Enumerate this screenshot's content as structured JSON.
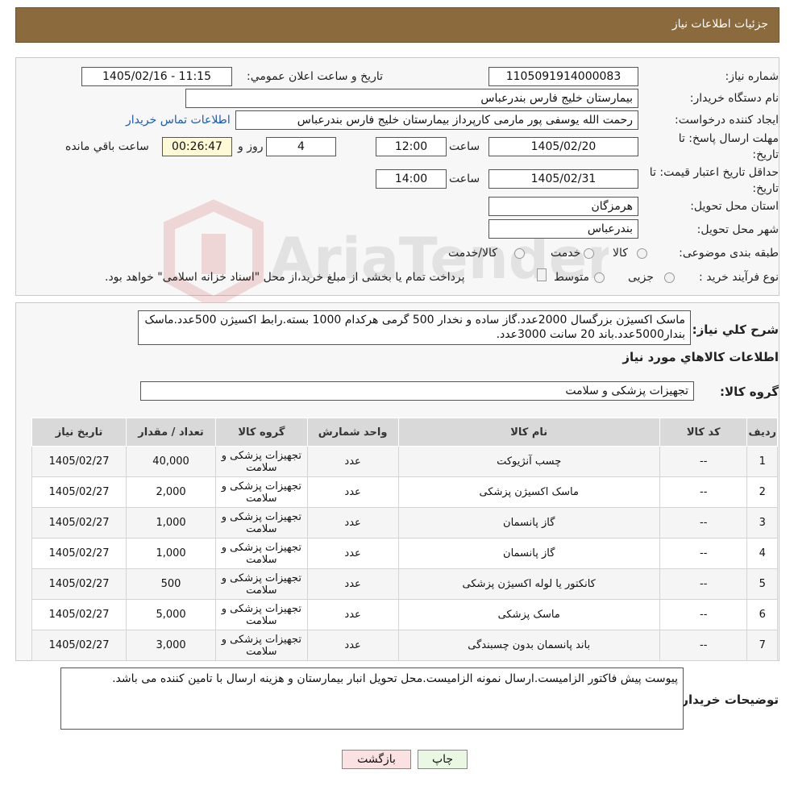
{
  "header": {
    "title": "جزئیات اطلاعات نیاز"
  },
  "need_number": {
    "label": "شماره نیاز:",
    "value": "1105091914000083"
  },
  "announce_date": {
    "label": "تاریخ و ساعت اعلان عمومي:",
    "value": "1405/02/16 - 11:15"
  },
  "buyer_org": {
    "label": "نام دستگاه خريدار:",
    "value": "بیمارستان خلیج فارس بندرعباس"
  },
  "requester": {
    "label": "ايجاد کننده درخواست:",
    "value": "رحمت الله یوسفی پور مارمی کارپرداز بیمارستان خلیج فارس بندرعباس",
    "contact_link": "اطلاعات تماس خريدار"
  },
  "reply_deadline": {
    "label_line1": "مهلت ارسال پاسخ: تا",
    "label_line2": "تاريخ:",
    "date": "1405/02/20",
    "time_label": "ساعت",
    "time": "12:00",
    "days": "4",
    "days_label": "روز و",
    "remaining": "00:26:47",
    "remaining_label": "ساعت باقي مانده"
  },
  "price_validity": {
    "label_line1": "حداقل تاريخ اعتبار قيمت: تا",
    "label_line2": "تاريخ:",
    "date": "1405/02/31",
    "time_label": "ساعت",
    "time": "14:00"
  },
  "province": {
    "label": "استان محل تحويل:",
    "value": "هرمزگان"
  },
  "city": {
    "label": "شهر محل تحويل:",
    "value": "بندرعباس"
  },
  "category": {
    "label": "طبقه بندی موضوعی:",
    "options": [
      "کالا",
      "خدمت",
      "کالا/خدمت"
    ]
  },
  "purchase_type": {
    "label": "نوع فرآیند خرید :",
    "options": [
      "جزیی",
      "متوسط"
    ],
    "note": "پرداخت تمام یا بخشی از مبلغ خرید،از محل \"اسناد خزانه اسلامی\" خواهد بود."
  },
  "watermark": {
    "text": "AriaTender.neT"
  },
  "description": {
    "label": "شرح کلي نياز:",
    "value": "ماسک اکسیژن بزرگسال 2000عدد.گاز ساده و نخدار 500 گرمی هرکدام 1000 بسته.رابط اکسیژن 500عدد.ماسک بندار5000عدد.باند 20 سانت 3000عدد."
  },
  "goods_info_title": "اطلاعات کالاهاي مورد نياز",
  "goods_group": {
    "label": "گروه کالا:",
    "value": "تجهیزات پزشکی و سلامت"
  },
  "table": {
    "headers": [
      "رديف",
      "کد کالا",
      "نام کالا",
      "واحد شمارش",
      "گروه کالا",
      "تعداد / مقدار",
      "تاریخ نیاز"
    ],
    "rows": [
      {
        "row": "1",
        "code": "--",
        "name": "چسب آنژیوکت",
        "unit": "عدد",
        "group": "تجهیزات پزشکی و سلامت",
        "qty": "40,000",
        "date": "1405/02/27"
      },
      {
        "row": "2",
        "code": "--",
        "name": "ماسک اکسیژن پزشکی",
        "unit": "عدد",
        "group": "تجهیزات پزشکی و سلامت",
        "qty": "2,000",
        "date": "1405/02/27"
      },
      {
        "row": "3",
        "code": "--",
        "name": "گاز پانسمان",
        "unit": "عدد",
        "group": "تجهیزات پزشکی و سلامت",
        "qty": "1,000",
        "date": "1405/02/27"
      },
      {
        "row": "4",
        "code": "--",
        "name": "گاز پانسمان",
        "unit": "عدد",
        "group": "تجهیزات پزشکی و سلامت",
        "qty": "1,000",
        "date": "1405/02/27"
      },
      {
        "row": "5",
        "code": "--",
        "name": "کانکتور یا لوله اکسیژن پزشکی",
        "unit": "عدد",
        "group": "تجهیزات پزشکی و سلامت",
        "qty": "500",
        "date": "1405/02/27"
      },
      {
        "row": "6",
        "code": "--",
        "name": "ماسک پزشکی",
        "unit": "عدد",
        "group": "تجهیزات پزشکی و سلامت",
        "qty": "5,000",
        "date": "1405/02/27"
      },
      {
        "row": "7",
        "code": "--",
        "name": "باند پانسمان بدون چسبندگی",
        "unit": "عدد",
        "group": "تجهیزات پزشکی و سلامت",
        "qty": "3,000",
        "date": "1405/02/27"
      }
    ]
  },
  "buyer_notes": {
    "label": "توضيحات خريدار:",
    "value": "پیوست پیش فاکتور الزامیست.ارسال نمونه الزامیست.محل تحویل انبار بیمارستان و هزینه ارسال با تامین کننده می باشد."
  },
  "buttons": {
    "print": "چاپ",
    "back": "بازگشت"
  },
  "colors": {
    "header_bg": "#8b6a3e",
    "link": "#1b59b5",
    "print_bg": "#eaf7e2",
    "back_bg": "#fbe1e1"
  }
}
